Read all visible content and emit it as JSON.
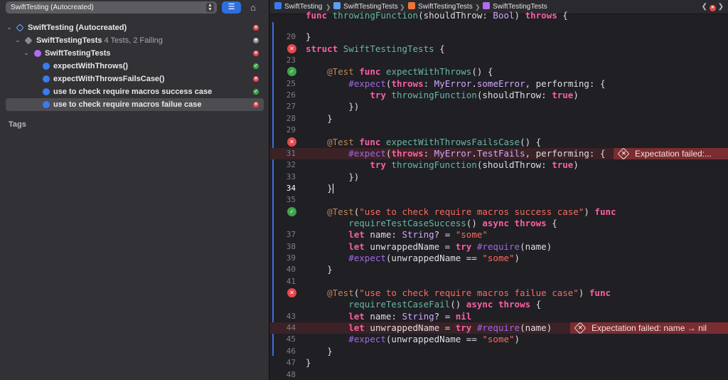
{
  "navigator": {
    "scheme_label": "SwiftTesting (Autocreated)",
    "filter_icon": "list-filter-icon",
    "tag_icon": "tag-icon",
    "tree": [
      {
        "label": "SwiftTesting (Autocreated)",
        "sub": "",
        "icon": "test-plan-icon",
        "status": "fail"
      },
      {
        "label": "SwiftTestingTests",
        "sub": "4 Tests, 2 Failing",
        "icon": "test-target-icon",
        "status": "skip"
      },
      {
        "label": "SwiftTestingTests",
        "sub": "",
        "icon": "suite-icon",
        "status": "fail"
      },
      {
        "label": "expectWithThrows()",
        "sub": "",
        "icon": "test-icon",
        "status": "pass"
      },
      {
        "label": "expectWithThrowsFailsCase()",
        "sub": "",
        "icon": "test-icon",
        "status": "fail"
      },
      {
        "label": "use to check require macros success case",
        "sub": "",
        "icon": "test-icon",
        "status": "pass"
      },
      {
        "label": "use to check require macros failue case",
        "sub": "",
        "icon": "test-icon",
        "status": "fail"
      }
    ],
    "tags_header": "Tags"
  },
  "jumpbar": {
    "crumbs": [
      "SwiftTesting",
      "SwiftTestingTests",
      "SwiftTestingTests",
      "SwiftTestingTests"
    ],
    "crumb_icons": [
      "project-icon",
      "folder-icon",
      "swift-file-icon",
      "struct-icon"
    ]
  },
  "editor": {
    "current_line": 34,
    "lines": [
      {
        "n": "",
        "text": "func throwingFunction(shouldThrow: Bool) throws {"
      },
      {
        "n": "20",
        "text": "}"
      },
      {
        "n": "",
        "text": "struct SwiftTestingTests {",
        "gutter": "fail"
      },
      {
        "n": "23",
        "text": ""
      },
      {
        "n": "",
        "text": "    @Test func expectWithThrows() {",
        "gutter": "pass"
      },
      {
        "n": "25",
        "text": "        #expect(throws: MyError.someError, performing: {"
      },
      {
        "n": "26",
        "text": "            try throwingFunction(shouldThrow: true)"
      },
      {
        "n": "27",
        "text": "        })"
      },
      {
        "n": "28",
        "text": "    }"
      },
      {
        "n": "29",
        "text": ""
      },
      {
        "n": "",
        "text": "    @Test func expectWithThrowsFailsCase() {",
        "gutter": "fail"
      },
      {
        "n": "31",
        "text": "        #expect(throws: MyError.TestFails, performing: {",
        "error": true
      },
      {
        "n": "32",
        "text": "            try throwingFunction(shouldThrow: true)"
      },
      {
        "n": "33",
        "text": "        })"
      },
      {
        "n": "34",
        "text": "    }"
      },
      {
        "n": "35",
        "text": ""
      },
      {
        "n": "",
        "text": "    @Test(\"use to check require macros success case\") func",
        "gutter": "pass"
      },
      {
        "n": "",
        "text": "        requireTestCaseSuccess() async throws {"
      },
      {
        "n": "37",
        "text": "        let name: String? = \"some\""
      },
      {
        "n": "38",
        "text": "        let unwrappedName = try #require(name)"
      },
      {
        "n": "39",
        "text": "        #expect(unwrappedName == \"some\")"
      },
      {
        "n": "40",
        "text": "    }"
      },
      {
        "n": "41",
        "text": ""
      },
      {
        "n": "",
        "text": "    @Test(\"use to check require macros failue case\") func",
        "gutter": "fail"
      },
      {
        "n": "",
        "text": "        requireTestCaseFail() async throws {"
      },
      {
        "n": "43",
        "text": "        let name: String? = nil"
      },
      {
        "n": "44",
        "text": "        let unwrappedName = try #require(name)",
        "error": true
      },
      {
        "n": "45",
        "text": "        #expect(unwrappedName == \"some\")"
      },
      {
        "n": "46",
        "text": "    }"
      },
      {
        "n": "47",
        "text": "}"
      },
      {
        "n": "48",
        "text": ""
      }
    ],
    "banners": [
      {
        "line_index": 11,
        "text": "Expectation failed:..."
      },
      {
        "line_index": 26,
        "text": "Expectation failed: name → nil"
      }
    ]
  }
}
